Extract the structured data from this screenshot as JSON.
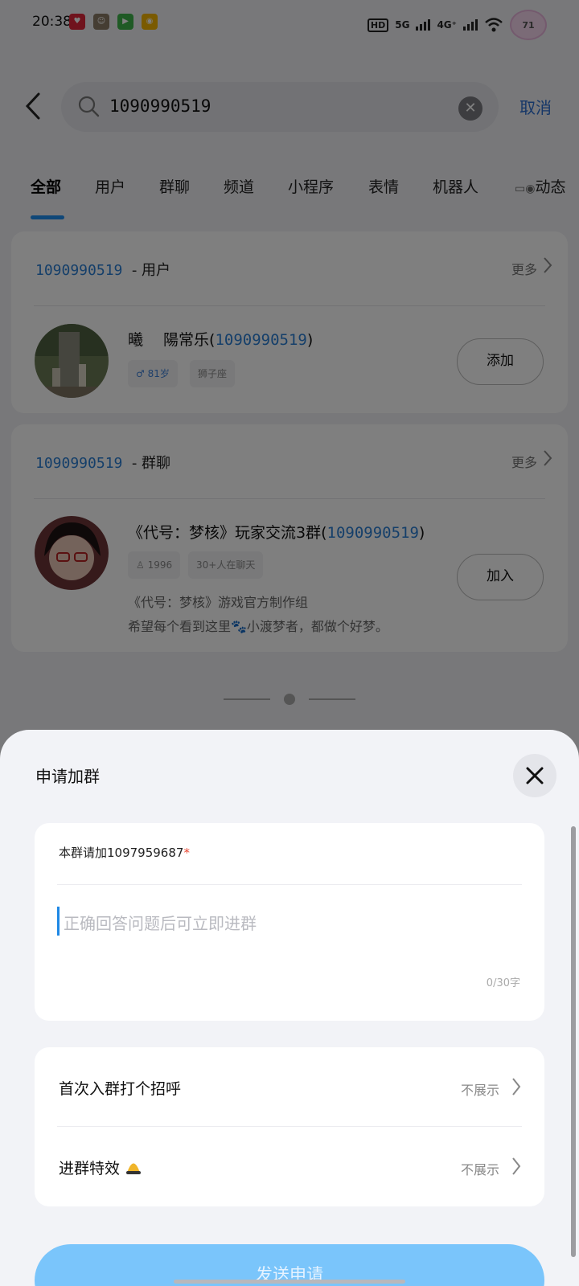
{
  "status": {
    "time": "20:38",
    "network_hd": "HD",
    "network_5g": "5G",
    "network_4g": "4G⁺",
    "badge": "71"
  },
  "search": {
    "query": "1090990519",
    "cancel_label": "取消"
  },
  "tabs": [
    "全部",
    "用户",
    "群聊",
    "频道",
    "小程序",
    "表情",
    "机器人",
    "动态"
  ],
  "user_section": {
    "query": "1090990519",
    "title": "- 用户",
    "more": "更多",
    "item": {
      "name": "曦　 陽常乐(",
      "id": "1090990519",
      "close": ")",
      "gender_age": "♂ 81岁",
      "constellation": "狮子座",
      "action": "添加"
    }
  },
  "group_section": {
    "query": "1090990519",
    "title": "- 群聊",
    "more": "更多",
    "item": {
      "name": "《代号：梦核》玩家交流3群(",
      "id": "1090990519",
      "close": ")",
      "members": "1996",
      "chatting": "30+人在聊天",
      "desc_line1": "《代号：梦核》游戏官方制作组",
      "desc_line2": "希望每个看到这里🐾小渡梦者，都做个好梦。",
      "action": "加入"
    }
  },
  "sheet": {
    "title": "申请加群",
    "question_label": "本群请加1097959687",
    "required_mark": "*",
    "answer_placeholder": "正确回答问题后可立即进群",
    "char_count": "0/30字",
    "greeting_label": "首次入群打个招呼",
    "greeting_value": "不展示",
    "effect_label": "进群特效",
    "effect_value": "不展示",
    "send_label": "发送申请"
  },
  "colors": {
    "accent": "#1e8ef0",
    "link": "#2b7fd4",
    "send_button": "#7ac5fb"
  }
}
